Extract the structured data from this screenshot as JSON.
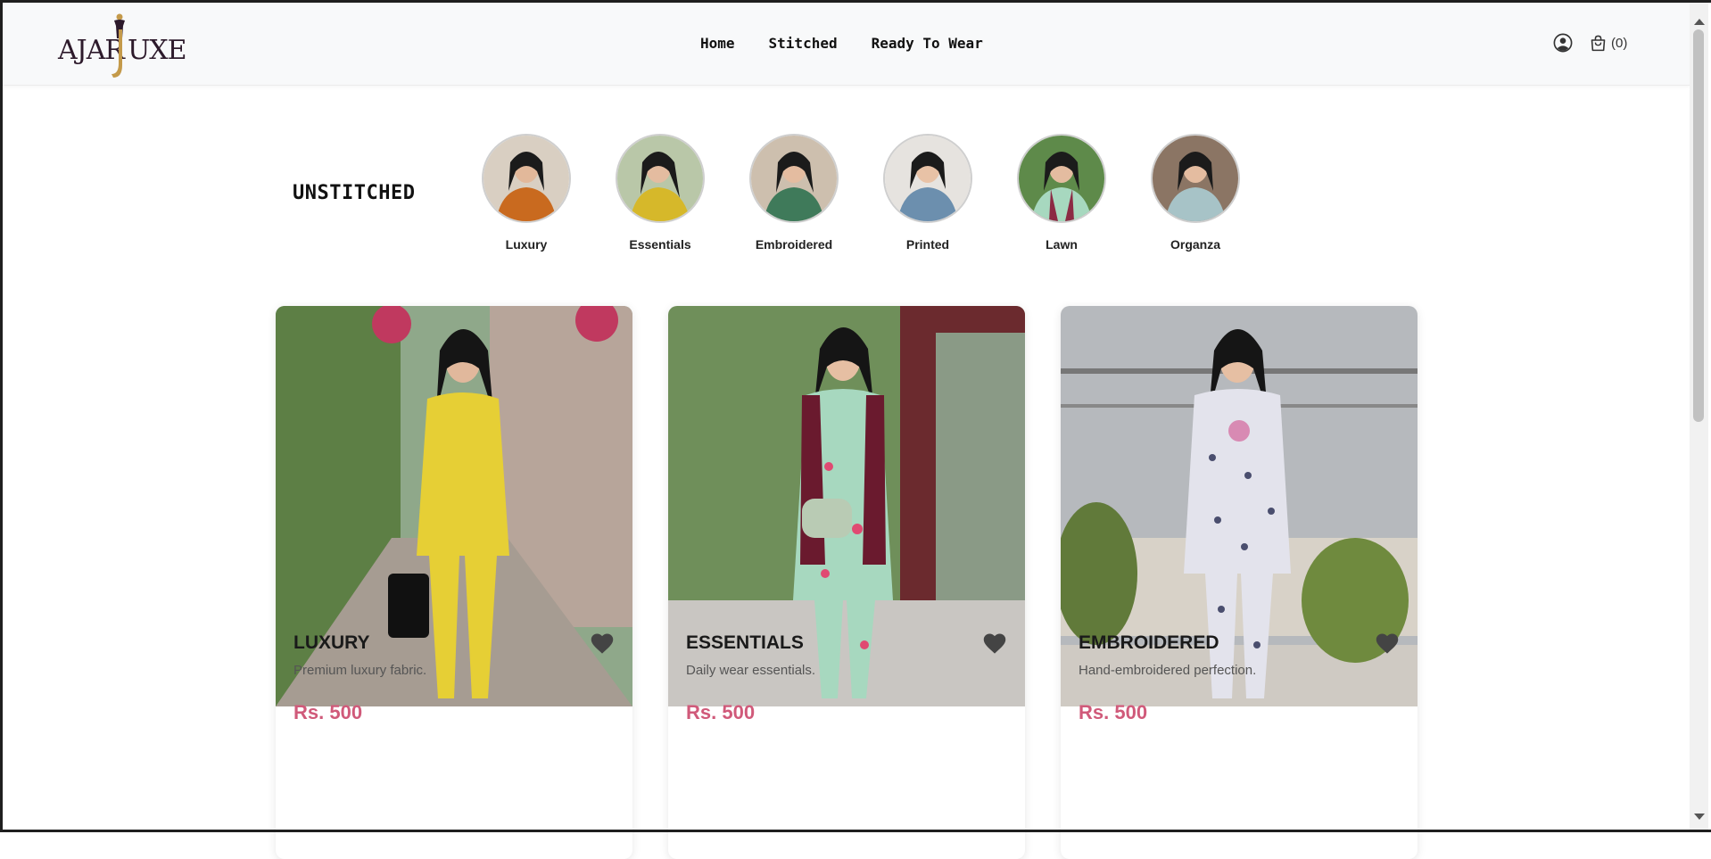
{
  "brand": {
    "logo_text_left": "AJAR",
    "logo_text_right": "UXE",
    "logo_mark": "J",
    "logo_colors": {
      "text": "#2d1a2b",
      "gold": "#c49a4a"
    }
  },
  "nav": {
    "items": [
      {
        "label": "Home"
      },
      {
        "label": "Stitched"
      },
      {
        "label": "Ready To Wear"
      }
    ]
  },
  "header_icons": {
    "account_icon": "user-circle-icon",
    "cart_icon": "shopping-bag-icon",
    "cart_count": "(0)"
  },
  "unstitched": {
    "title": "UNSTITCHED",
    "categories": [
      {
        "label": "Luxury",
        "swatch": "#c96a1f"
      },
      {
        "label": "Essentials",
        "swatch": "#d6b82a"
      },
      {
        "label": "Embroidered",
        "swatch": "#3f7a5a"
      },
      {
        "label": "Printed",
        "swatch": "#6c8fae"
      },
      {
        "label": "Lawn",
        "swatch": "#8c2a44"
      },
      {
        "label": "Organza",
        "swatch": "#a7c3c7"
      }
    ]
  },
  "products": [
    {
      "title": "LUXURY",
      "desc": "Premium luxury fabric.",
      "price": "Rs. 500",
      "outfit": "#e6cf35"
    },
    {
      "title": "ESSENTIALS",
      "desc": "Daily wear essentials.",
      "price": "Rs. 500",
      "outfit": "#a7d8bf"
    },
    {
      "title": "EMBROIDERED",
      "desc": "Hand-embroidered perfection.",
      "price": "Rs. 500",
      "outfit": "#e3e3ec"
    }
  ],
  "colors": {
    "price": "#d05a7a",
    "heart": "#444444",
    "nav_text": "#111111"
  }
}
